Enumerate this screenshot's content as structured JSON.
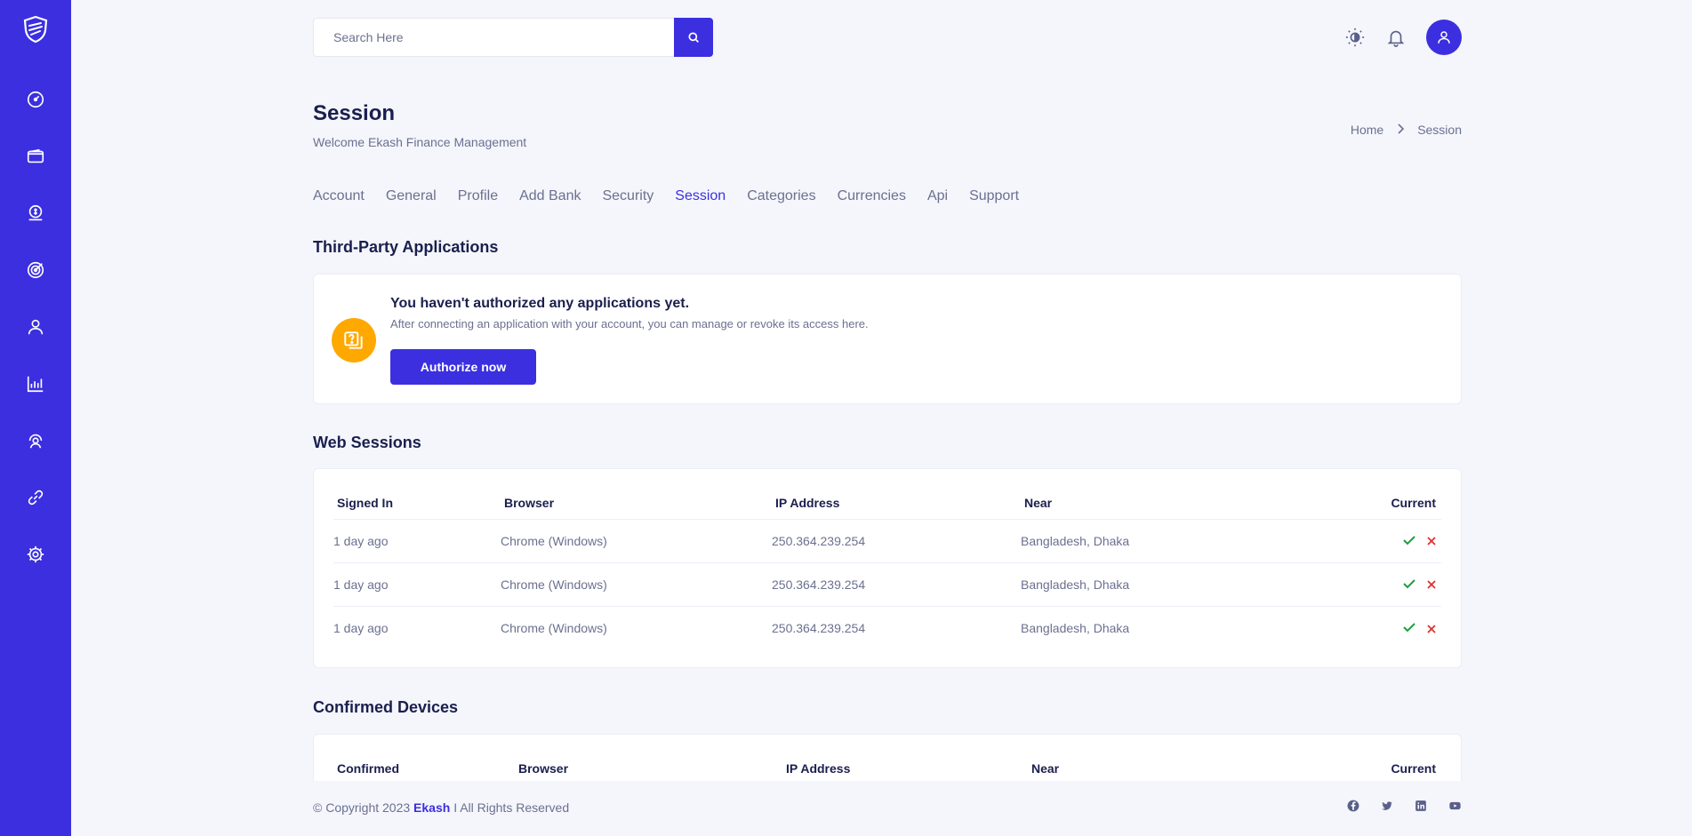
{
  "search": {
    "placeholder": "Search Here"
  },
  "page": {
    "title": "Session",
    "subtitle": "Welcome Ekash Finance Management"
  },
  "breadcrumb": {
    "home": "Home",
    "current": "Session"
  },
  "tabs": [
    {
      "label": "Account"
    },
    {
      "label": "General"
    },
    {
      "label": "Profile"
    },
    {
      "label": "Add Bank"
    },
    {
      "label": "Security"
    },
    {
      "label": "Session",
      "active": true
    },
    {
      "label": "Categories"
    },
    {
      "label": "Currencies"
    },
    {
      "label": "Api"
    },
    {
      "label": "Support"
    }
  ],
  "third_party": {
    "title": "Third-Party Applications",
    "message_title": "You haven't authorized any applications yet.",
    "message_text": "After connecting an application with your account, you can manage or revoke its access here.",
    "button": "Authorize now"
  },
  "web_sessions": {
    "title": "Web Sessions",
    "columns": [
      "Signed In",
      "Browser",
      "IP Address",
      "Near",
      "Current"
    ],
    "rows": [
      [
        "1 day ago",
        "Chrome (Windows)",
        "250.364.239.254",
        "Bangladesh, Dhaka"
      ],
      [
        "1 day ago",
        "Chrome (Windows)",
        "250.364.239.254",
        "Bangladesh, Dhaka"
      ],
      [
        "1 day ago",
        "Chrome (Windows)",
        "250.364.239.254",
        "Bangladesh, Dhaka"
      ]
    ]
  },
  "confirmed_devices": {
    "title": "Confirmed Devices",
    "columns": [
      "Confirmed",
      "Browser",
      "IP Address",
      "Near",
      "Current"
    ]
  },
  "footer": {
    "copy_prefix": "© Copyright 2023",
    "brand": "Ekash",
    "copy_suffix": "I All Rights Reserved"
  },
  "colors": {
    "primary": "#3b2fe0",
    "accent": "#ffa800",
    "success": "#1e9e3e",
    "danger": "#e03131",
    "text": "#1a1f4d",
    "muted": "#6b7090"
  },
  "icons": {
    "sidebar": [
      "dashboard-icon",
      "wallet-icon",
      "budget-icon",
      "goals-icon",
      "profile-icon",
      "analytics-icon",
      "support-icon",
      "link-icon",
      "settings-icon"
    ],
    "topbar": [
      "theme-toggle-icon",
      "bell-icon",
      "user-icon"
    ],
    "footer": [
      "facebook-icon",
      "twitter-icon",
      "linkedin-icon",
      "youtube-icon"
    ]
  }
}
